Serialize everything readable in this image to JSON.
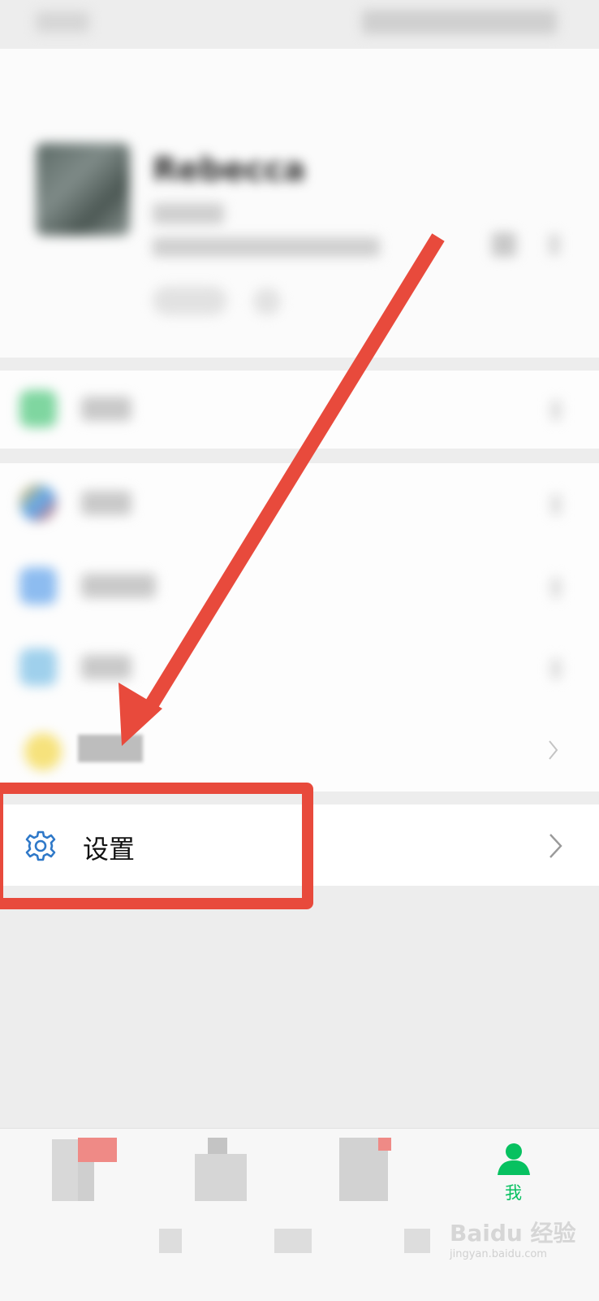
{
  "profile": {
    "nickname": "Rebecca"
  },
  "settings_row": {
    "label": "设置"
  },
  "tabbar": {
    "me_label": "我"
  },
  "watermark": {
    "main": "Baidu 经验",
    "sub": "jingyan.baidu.com"
  },
  "colors": {
    "accent_green": "#07c160",
    "annotation_red": "#e84a3c",
    "settings_icon_blue": "#2e78c8"
  }
}
